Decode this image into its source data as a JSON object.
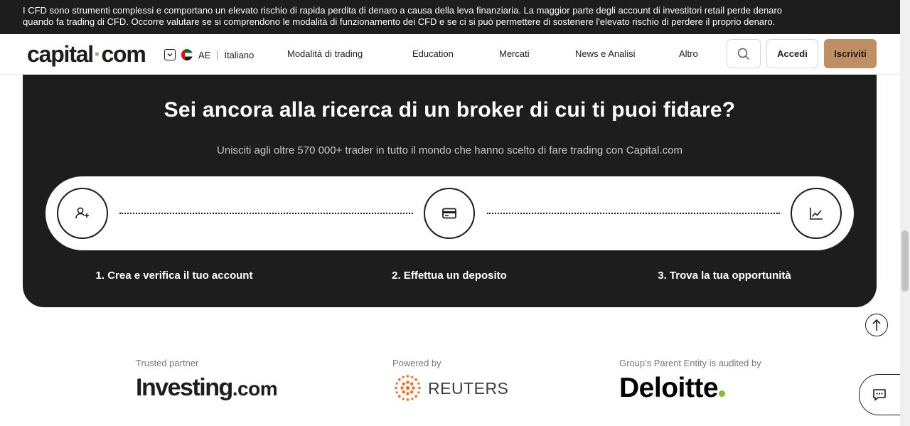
{
  "risk_warning": {
    "line1": "I CFD sono strumenti complessi e comportano un elevato rischio di rapida perdita di denaro a causa della leva finanziaria. La maggior parte degli account di investitori retail perde denaro",
    "line2": "quando fa trading di CFD. Occorre valutare se si comprendono le modalità di funzionamento dei CFD e se ci si può permettere di sostenere l'elevato rischio di perdere il proprio denaro."
  },
  "header": {
    "logo_left": "capital",
    "logo_dot": "·",
    "logo_right": "com",
    "region_code": "AE",
    "language": "Italiano",
    "nav": [
      "Modalità di trading",
      "Education",
      "Mercati",
      "News e Analisi",
      "Altro"
    ],
    "login_label": "Accedi",
    "signup_label": "Iscriviti"
  },
  "hero": {
    "title": "Sei ancora alla ricerca di un broker di cui ti puoi fidare?",
    "subtitle": "Unisciti agli oltre 570 000+ trader in tutto il mondo che hanno scelto di fare trading con Capital.com",
    "steps": [
      {
        "label": "1. Crea e verifica il tuo account",
        "icon": "add-user-icon"
      },
      {
        "label": "2. Effettua un deposito",
        "icon": "credit-card-icon"
      },
      {
        "label": "3. Trova la tua opportunità",
        "icon": "line-chart-icon"
      }
    ]
  },
  "partners": [
    {
      "caption": "Trusted partner",
      "name_main": "Investing",
      "name_suffix": ".com"
    },
    {
      "caption": "Powered by",
      "name": "REUTERS"
    },
    {
      "caption": "Group's Parent Entity is audited by",
      "name": "Deloitte"
    }
  ],
  "colors": {
    "banner_bg": "#1d1d1d",
    "brand_accent": "#bd8f63",
    "deloitte_green": "#86bc25",
    "reuters_orange": "#f26b21"
  },
  "icons": {
    "region_toggle": "chevron-down-icon",
    "flag": "uae-flag-icon",
    "search": "search-icon",
    "back_to_top": "arrow-up-icon",
    "chat": "chat-icon"
  }
}
